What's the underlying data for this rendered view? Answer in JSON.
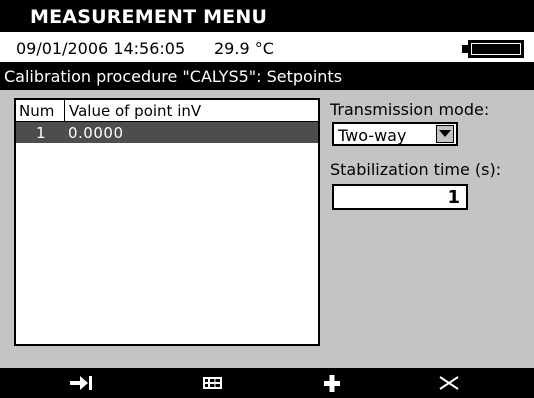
{
  "window": {
    "title": "MEASUREMENT MENU"
  },
  "status": {
    "datetime": "09/01/2006 14:56:05",
    "temperature": "29.9 °C",
    "battery_icon": "battery-icon"
  },
  "panel": {
    "title": "Calibration procedure \"CALYS5\": Setpoints"
  },
  "list": {
    "columns": [
      "Num",
      "Value of point inV"
    ],
    "rows": [
      {
        "num": "1",
        "value": "0.0000",
        "selected": true
      }
    ]
  },
  "transmission": {
    "label": "Transmission mode:",
    "value": "Two-way",
    "dropdown_icon": "chevron-down-icon"
  },
  "stabilization": {
    "label": "Stabilization time (s):",
    "value": "1"
  },
  "softkeys": [
    {
      "icon": "arrow-right-to-bar-icon"
    },
    {
      "icon": "table-icon"
    },
    {
      "icon": "plus-icon"
    },
    {
      "icon": "delete-x-icon"
    }
  ],
  "colors": {
    "bar_black": "#000000",
    "panel_gray": "#c4c4c4",
    "selection_gray": "#4d4d4d",
    "white": "#ffffff"
  }
}
